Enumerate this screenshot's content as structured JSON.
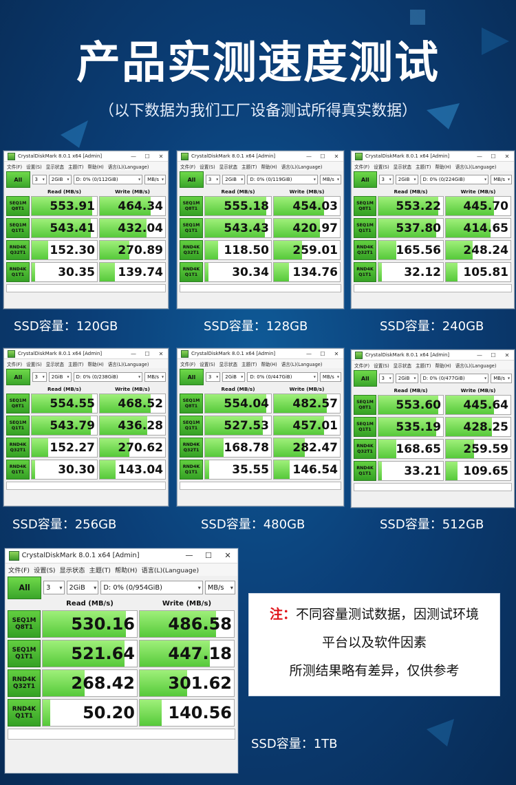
{
  "page": {
    "title": "产品实测速度测试",
    "subtitle": "（以下数据为我们工厂设备测试所得真实数据）",
    "note_prefix": "注：",
    "note_lines": [
      "不同容量测试数据，因测试环境",
      "平台以及软件因素",
      "所测结果略有差异，仅供参考"
    ]
  },
  "app": {
    "window_title": "CrystalDiskMark 8.0.1 x64 [Admin]",
    "menu": [
      "文件(F)",
      "设置(S)",
      "显示状态",
      "主题(T)",
      "帮助(H)",
      "语言(L)(Language)"
    ],
    "all_button": "All",
    "count": "3",
    "size": "2GiB",
    "unit": "MB/s",
    "read_header": "Read (MB/s)",
    "write_header": "Write (MB/s)",
    "row_labels": [
      [
        "SEQ1M",
        "Q8T1"
      ],
      [
        "SEQ1M",
        "Q1T1"
      ],
      [
        "RND4K",
        "Q32T1"
      ],
      [
        "RND4K",
        "Q1T1"
      ]
    ],
    "minimize_icon": "—",
    "maximize_icon": "☐",
    "close_icon": "✕",
    "dropdown_arrow": "▾"
  },
  "results": [
    {
      "drive": "D: 0% (0/112GiB)",
      "caption": "SSD容量：120GB",
      "read": [
        "553.91",
        "543.41",
        "152.30",
        "30.35"
      ],
      "write": [
        "464.34",
        "432.04",
        "270.89",
        "139.74"
      ]
    },
    {
      "drive": "D: 0% (0/119GiB)",
      "caption": "SSD容量：128GB",
      "read": [
        "555.18",
        "543.43",
        "118.50",
        "30.34"
      ],
      "write": [
        "454.03",
        "420.97",
        "259.01",
        "134.76"
      ]
    },
    {
      "drive": "D: 0% (0/224GiB)",
      "caption": "SSD容量：240GB",
      "read": [
        "553.22",
        "537.80",
        "165.56",
        "32.12"
      ],
      "write": [
        "445.70",
        "414.65",
        "248.24",
        "105.81"
      ]
    },
    {
      "drive": "D: 0% (0/238GiB)",
      "caption": "SSD容量：256GB",
      "read": [
        "554.55",
        "543.79",
        "152.27",
        "30.30"
      ],
      "write": [
        "468.52",
        "436.28",
        "270.62",
        "143.04"
      ]
    },
    {
      "drive": "D: 0% (0/447GiB)",
      "caption": "SSD容量：480GB",
      "read": [
        "554.04",
        "527.53",
        "168.78",
        "35.55"
      ],
      "write": [
        "482.57",
        "457.01",
        "282.47",
        "146.54"
      ]
    },
    {
      "drive": "D: 0% (0/477GiB)",
      "caption": "SSD容量：512GB",
      "read": [
        "553.60",
        "535.19",
        "168.65",
        "33.21"
      ],
      "write": [
        "445.64",
        "428.25",
        "259.59",
        "109.65"
      ]
    },
    {
      "drive": "D: 0% (0/954GiB)",
      "caption": "SSD容量：1TB",
      "read": [
        "530.16",
        "521.64",
        "268.42",
        "50.20"
      ],
      "write": [
        "486.58",
        "447.18",
        "301.62",
        "140.56"
      ]
    }
  ],
  "colors": {
    "accent_green": "#56c93a",
    "note_red": "#e0141a",
    "background": "#0b3f78"
  }
}
